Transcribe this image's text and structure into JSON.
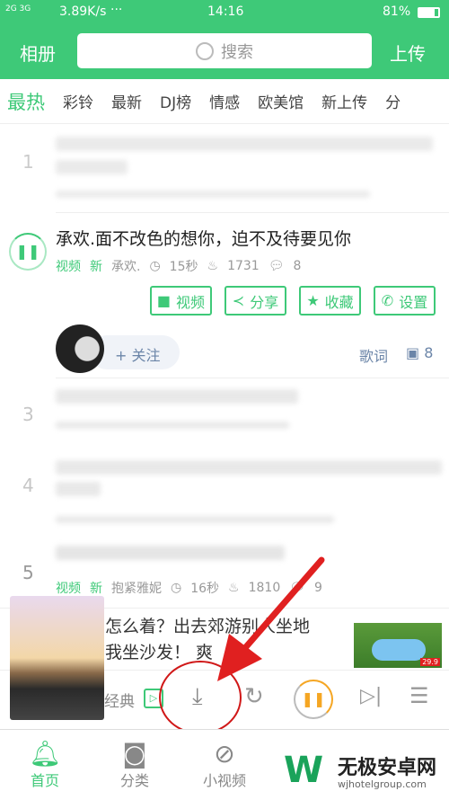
{
  "status": {
    "signal": "2G 3G",
    "speed": "3.89K/s",
    "dots": "···",
    "time": "14:16",
    "battery": "81%"
  },
  "header": {
    "album": "相册",
    "search_placeholder": "搜索",
    "upload": "上传"
  },
  "tabs": [
    "最热",
    "彩铃",
    "最新",
    "DJ榜",
    "情感",
    "欧美馆",
    "新上传",
    "分"
  ],
  "rows": [
    {
      "rank": "1"
    },
    {
      "title": "承欢.面不改色的想你，迫不及待要见你",
      "tag_video": "视频",
      "tag_new": "新",
      "author": "承欢.",
      "duration": "15秒",
      "likes": "1731",
      "comments": "8",
      "actions": [
        "视频",
        "分享",
        "收藏",
        "设置"
      ],
      "follow": "+ 关注",
      "lyrics": "歌词",
      "comment_count": "8"
    },
    {
      "rank": "3"
    },
    {
      "rank": "4"
    },
    {
      "rank": "5",
      "tag_video": "视频",
      "tag_new": "新",
      "author": "抱紧雅妮",
      "duration": "16秒",
      "likes": "1810",
      "comments": "9"
    }
  ],
  "ad": {
    "text_line1": "怎么着？出去郊游别人坐地",
    "text_line2": "我坐沙发！ 爽",
    "price_badge": "29.9"
  },
  "player": {
    "label": "经典"
  },
  "nav": [
    "首页",
    "分类",
    "小视频"
  ],
  "watermark": {
    "name": "无极安卓网",
    "url": "wjhotelgroup.com"
  },
  "colors": {
    "brand": "#3ec978",
    "accent": "#f5a623",
    "annotation": "#e02020"
  }
}
